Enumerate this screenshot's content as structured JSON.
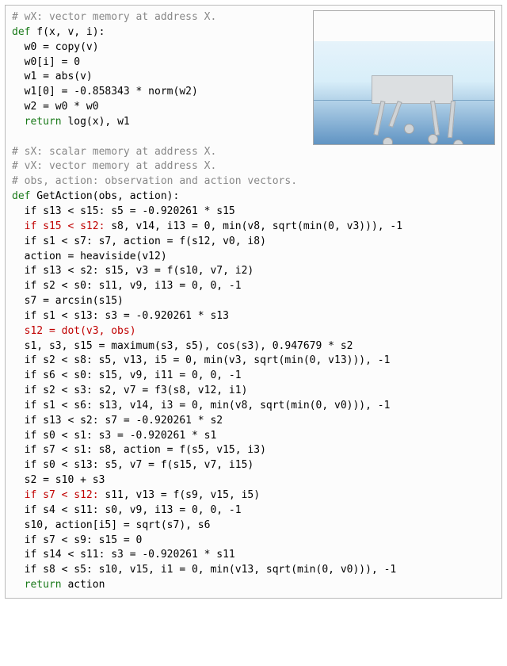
{
  "box": {
    "c1": "# wX: vector memory at address X.",
    "f_def_kw": "def",
    "f_def": " f(x, v, i):",
    "f_l1": "  w0 = copy(v)",
    "f_l2": "  w0[i] = 0",
    "f_l3": "  w1 = abs(v)",
    "f_l4": "  w1[0] = -0.858343 * norm(w2)",
    "f_l5": "  w2 = w0 * w0",
    "f_ret_kw": "  return",
    "f_ret": " log(x), w1",
    "c2a": "# sX: scalar memory at address X.",
    "c2b": "# vX: vector memory at address X.",
    "c2c": "# obs, action: observation and action vectors.",
    "g_def_kw": "def",
    "g_def": " GetAction(obs, action):",
    "g": {
      "l1": "  if s13 < s15: s5 = -0.920261 * s15",
      "l2a_hl": "  if s15 < s12:",
      "l2b": " s8, v14, i13 = 0, min(v8, sqrt(min(0, v3))), -1",
      "l3": "  if s1 < s7: s7, action = f(s12, v0, i8)",
      "l4": "  action = heaviside(v12)",
      "l5": "  if s13 < s2: s15, v3 = f(s10, v7, i2)",
      "l6": "  if s2 < s0: s11, v9, i13 = 0, 0, -1",
      "l7": "  s7 = arcsin(s15)",
      "l8": "  if s1 < s13: s3 = -0.920261 * s13",
      "l9_hl": "  s12 = dot(v3, obs)",
      "l10": "  s1, s3, s15 = maximum(s3, s5), cos(s3), 0.947679 * s2",
      "l11": "  if s2 < s8: s5, v13, i5 = 0, min(v3, sqrt(min(0, v13))), -1",
      "l12": "  if s6 < s0: s15, v9, i11 = 0, 0, -1",
      "l13": "  if s2 < s3: s2, v7 = f3(s8, v12, i1)",
      "l14": "  if s1 < s6: s13, v14, i3 = 0, min(v8, sqrt(min(0, v0))), -1",
      "l15": "  if s13 < s2: s7 = -0.920261 * s2",
      "l16": "  if s0 < s1: s3 = -0.920261 * s1",
      "l17": "  if s7 < s1: s8, action = f(s5, v15, i3)",
      "l18": "  if s0 < s13: s5, v7 = f(s15, v7, i15)",
      "l19": "  s2 = s10 + s3",
      "l20a_hl": "  if s7 < s12:",
      "l20b": " s11, v13 = f(s9, v15, i5)",
      "l21": "  if s4 < s11: s0, v9, i13 = 0, 0, -1",
      "l22": "  s10, action[i5] = sqrt(s7), s6",
      "l23": "  if s7 < s9: s15 = 0",
      "l24": "  if s14 < s11: s3 = -0.920261 * s11",
      "l25": "  if s8 < s5: s10, v15, i1 = 0, min(v13, sqrt(min(0, v0))), -1",
      "ret_kw": "  return",
      "ret": " action"
    }
  }
}
